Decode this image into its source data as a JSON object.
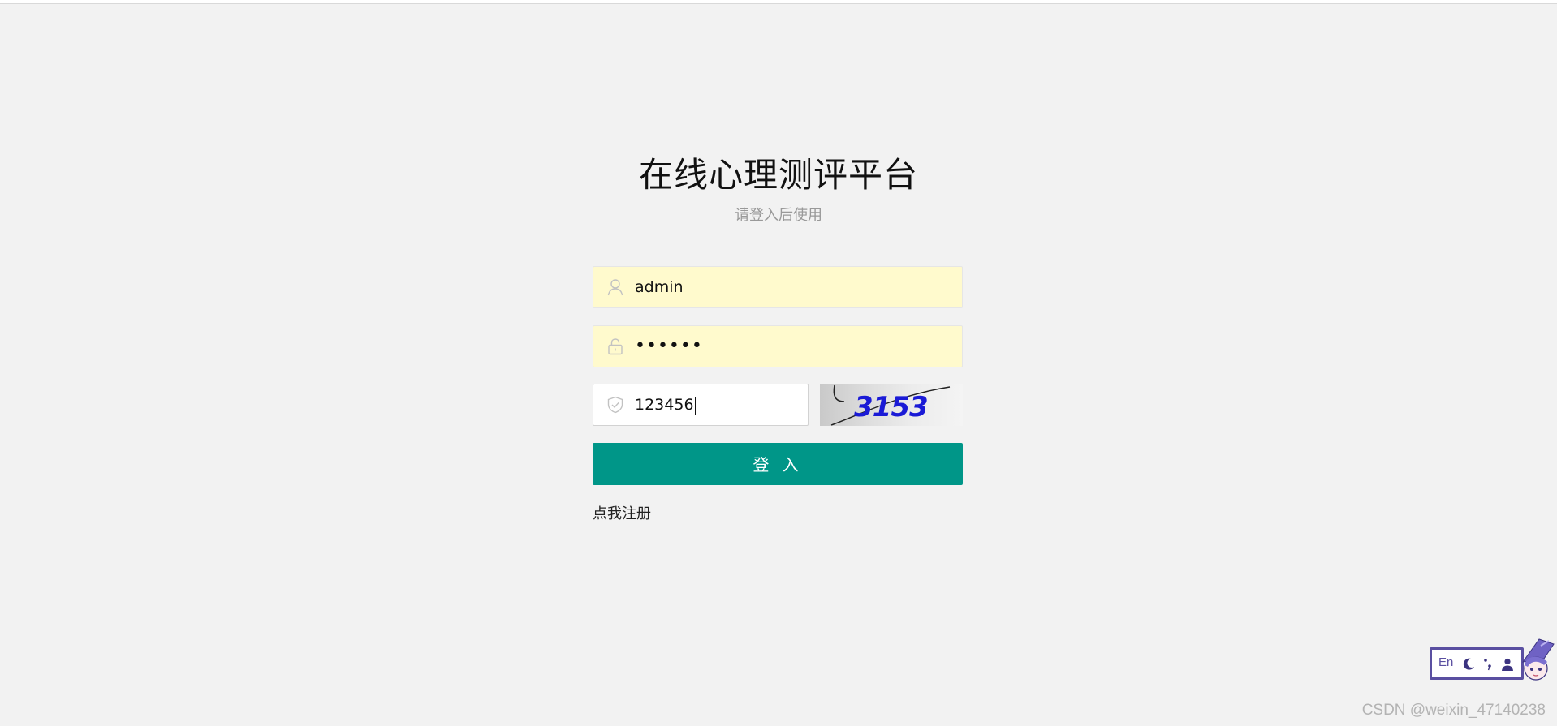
{
  "page": {
    "title": "在线心理测评平台",
    "subtitle": "请登入后使用"
  },
  "login_form": {
    "username_value": "admin",
    "password_value": "••••••",
    "captcha_value": "123456",
    "captcha_image_text": "3153",
    "submit_label": "登 入",
    "register_link": "点我注册"
  },
  "ime_toolbar": {
    "language": "En"
  },
  "watermark": "CSDN @weixin_47140238",
  "colors": {
    "background": "#f2f2f2",
    "primary_button": "#009688",
    "autofill_field": "#fffacd",
    "captcha_text": "#1a1ad6",
    "ime_accent": "#5a4fa1"
  },
  "icons": {
    "username": "user-icon",
    "password": "lock-icon",
    "captcha": "shield-check-icon"
  }
}
